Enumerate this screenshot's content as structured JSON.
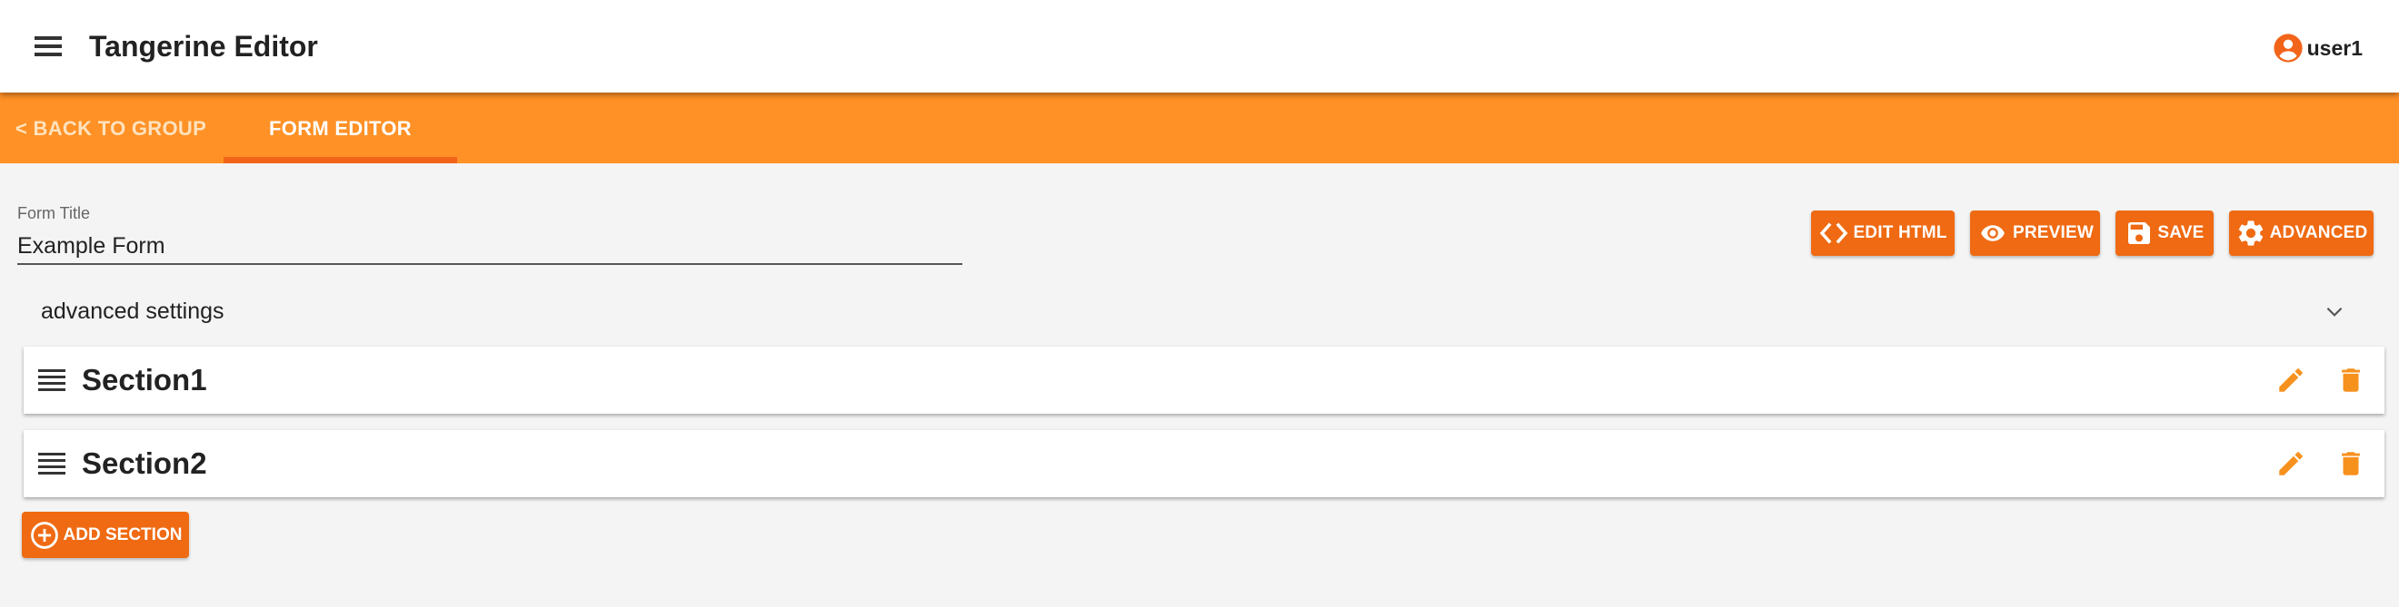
{
  "app": {
    "title": "Tangerine Editor"
  },
  "user": {
    "name": "user1",
    "icon": "account-circle-icon"
  },
  "tabs": {
    "back_label": "< BACK TO GROUP",
    "active_label": "FORM EDITOR"
  },
  "form": {
    "title_label": "Form Title",
    "title_value": "Example Form"
  },
  "toolbar": {
    "edit_html": "EDIT HTML",
    "preview": "PREVIEW",
    "save": "SAVE",
    "advanced": "ADVANCED"
  },
  "advanced_settings": {
    "label": "advanced settings"
  },
  "sections": [
    {
      "title": "Section1"
    },
    {
      "title": "Section2"
    }
  ],
  "add_section": {
    "label": "ADD SECTION"
  },
  "colors": {
    "primary_orange": "#ff9126",
    "button_orange": "#ef6a12",
    "icon_orange": "#f7911e",
    "tab_ink": "#f26419",
    "background": "#f4f4f4"
  }
}
